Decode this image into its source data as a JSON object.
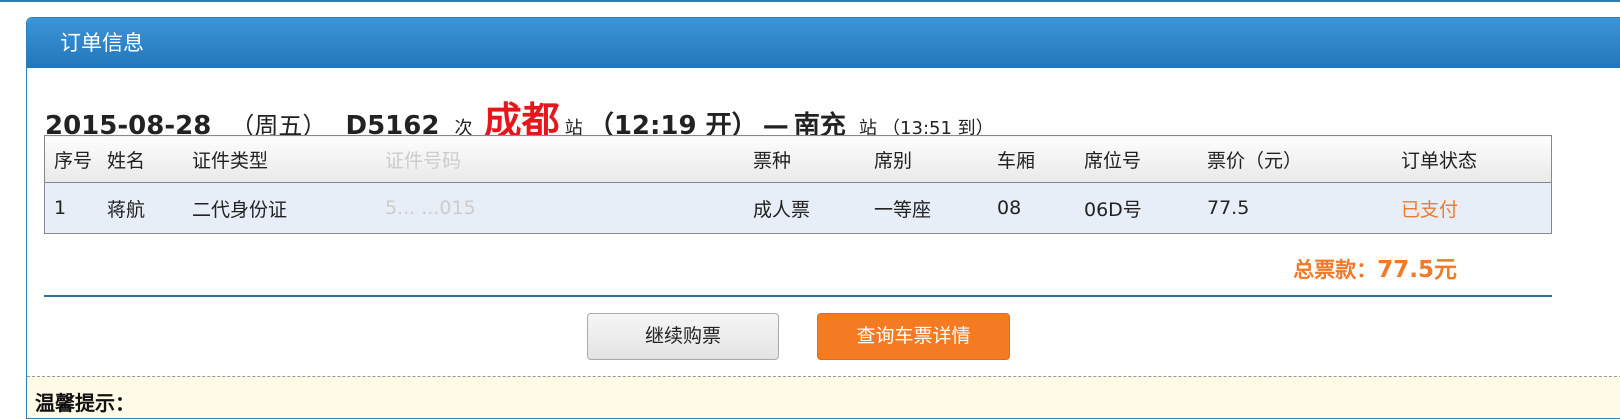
{
  "panel": {
    "title": "订单信息"
  },
  "trip": {
    "date": "2015-08-28",
    "weekday": "（周五）",
    "train_no": "D5162",
    "ci": "次",
    "from_station": "成都",
    "zhan1": "站",
    "depart": "（12:19 开）",
    "dash": "—",
    "to_station": "南充",
    "zhan2": "站",
    "arrive": "（13:51 到）"
  },
  "table": {
    "headers": [
      "序号",
      "姓名",
      "证件类型",
      "证件号码",
      "票种",
      "席别",
      "车厢",
      "席位号",
      "票价（元）",
      "订单状态"
    ],
    "rows": [
      {
        "no": "1",
        "name": "蒋航",
        "id_type": "二代身份证",
        "id_no": "5... ...015",
        "ticket_type": "成人票",
        "seat_class": "一等座",
        "car": "08",
        "seat_no": "06D号",
        "price": "77.5",
        "status": "已支付"
      }
    ]
  },
  "total": {
    "label": "总票款：",
    "amount": "77.5元"
  },
  "buttons": {
    "continue": "继续购票",
    "query": "查询车票详情"
  },
  "tips": {
    "title": "温馨提示："
  },
  "colors": {
    "accent": "#2f7fb3",
    "orange": "#f57b22",
    "red": "#e8161c"
  }
}
